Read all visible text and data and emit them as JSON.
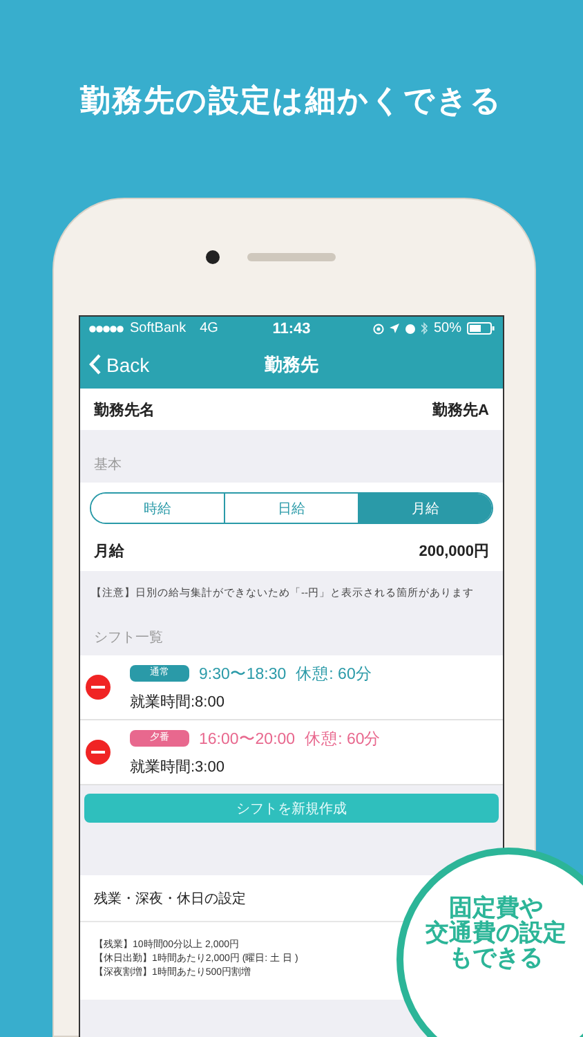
{
  "headline": "勤務先の設定は細かくできる",
  "status_bar": {
    "carrier": "SoftBank",
    "network": "4G",
    "time": "11:43",
    "battery": "50%"
  },
  "nav": {
    "back": "Back",
    "title": "勤務先"
  },
  "workplace": {
    "label": "勤務先名",
    "value": "勤務先A"
  },
  "basic": {
    "header": "基本",
    "pay_types": [
      {
        "label": "時給",
        "selected": false
      },
      {
        "label": "日給",
        "selected": false
      },
      {
        "label": "月給",
        "selected": true
      }
    ],
    "amount": {
      "label": "月給",
      "value": "200,000円"
    },
    "note": "【注意】日別の給与集計ができないため「--円」と表示される箇所があります"
  },
  "shifts": {
    "header": "シフト一覧",
    "items": [
      {
        "tag": "通常",
        "color": "#2a9aa8",
        "time": "9:30〜18:30",
        "break": "休憩: 60分",
        "hours": "就業時間:8:00"
      },
      {
        "tag": "夕番",
        "color": "#e8688e",
        "time": "16:00〜20:00",
        "break": "休憩: 60分",
        "hours": "就業時間:3:00"
      }
    ],
    "add_button": "シフトを新規作成"
  },
  "extra": {
    "title": "残業・深夜・休日の設定",
    "lines": [
      "【残業】10時間00分以上 2,000円",
      "【休日出勤】1時間あたり2,000円 (曜日: 土 日 )",
      "【深夜割増】1時間あたり500円割増"
    ]
  },
  "badge": [
    "固定費や",
    "交通費の設定",
    "もできる"
  ]
}
